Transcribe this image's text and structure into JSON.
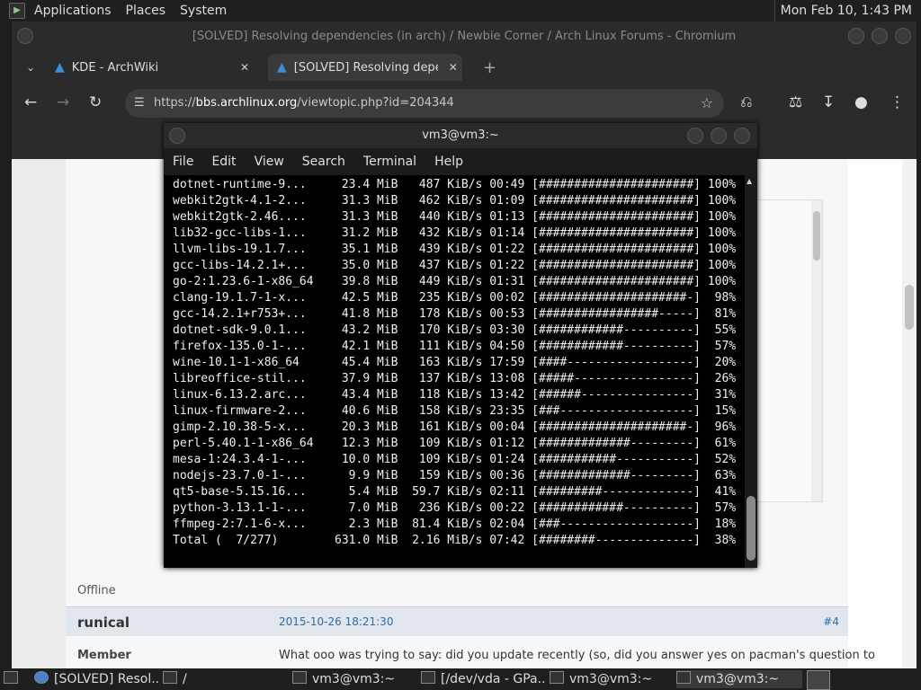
{
  "top_panel": {
    "menus": [
      "Applications",
      "Places",
      "System"
    ],
    "clock": "Mon Feb 10,  1:43 PM"
  },
  "chromium": {
    "title": "[SOLVED] Resolving dependencies (in arch) / Newbie Corner / Arch Linux Forums - Chromium",
    "tabs": [
      {
        "label": "KDE - ArchWiki"
      },
      {
        "label": "[SOLVED] Resolving depend"
      }
    ],
    "new_tab": "+",
    "url_prefix": "https://",
    "url_domain": "bbs.archlinux.org",
    "url_path": "/viewtopic.php?id=204344"
  },
  "forum": {
    "offline": "Offline",
    "author": "runical",
    "date": "2015-10-26 18:21:30",
    "post_num": "#4",
    "role": "Member",
    "text": "What ooo was trying to say: did you update recently (so, did you answer yes on pacman's question to"
  },
  "terminal": {
    "title": "vm3@vm3:~",
    "menu": [
      "File",
      "Edit",
      "View",
      "Search",
      "Terminal",
      "Help"
    ],
    "lines": [
      "dotnet-runtime-9...     23.4 MiB   487 KiB/s 00:49 [######################] 100%",
      "webkit2gtk-4.1-2...     31.3 MiB   462 KiB/s 01:09 [######################] 100%",
      "webkit2gtk-2.46....     31.3 MiB   440 KiB/s 01:13 [######################] 100%",
      "lib32-gcc-libs-1...     31.2 MiB   432 KiB/s 01:14 [######################] 100%",
      "llvm-libs-19.1.7...     35.1 MiB   439 KiB/s 01:22 [######################] 100%",
      "gcc-libs-14.2.1+...     35.0 MiB   437 KiB/s 01:22 [######################] 100%",
      "go-2:1.23.6-1-x86_64    39.8 MiB   449 KiB/s 01:31 [######################] 100%",
      "clang-19.1.7-1-x...     42.5 MiB   235 KiB/s 00:02 [#####################-]  98%",
      "gcc-14.2.1+r753+...     41.8 MiB   178 KiB/s 00:53 [#################-----]  81%",
      "dotnet-sdk-9.0.1...     43.2 MiB   170 KiB/s 03:30 [############----------]  55%",
      "firefox-135.0-1-...     42.1 MiB   111 KiB/s 04:50 [############----------]  57%",
      "wine-10.1-1-x86_64      45.4 MiB   163 KiB/s 17:59 [####------------------]  20%",
      "libreoffice-stil...     37.9 MiB   137 KiB/s 13:08 [#####-----------------]  26%",
      "linux-6.13.2.arc...     43.4 MiB   118 KiB/s 13:42 [######----------------]  31%",
      "linux-firmware-2...     40.6 MiB   158 KiB/s 23:35 [###-------------------]  15%",
      "gimp-2.10.38-5-x...     20.3 MiB   161 KiB/s 00:04 [#####################-]  96%",
      "perl-5.40.1-1-x86_64    12.3 MiB   109 KiB/s 01:12 [#############---------]  61%",
      "mesa-1:24.3.4-1-...     10.0 MiB   109 KiB/s 01:24 [###########-----------]  52%",
      "nodejs-23.7.0-1-...      9.9 MiB   159 KiB/s 00:36 [#############---------]  63%",
      "qt5-base-5.15.16...      5.4 MiB  59.7 KiB/s 02:11 [#########-------------]  41%",
      "python-3.13.1-1-...      7.0 MiB   236 KiB/s 00:22 [############----------]  57%",
      "ffmpeg-2:7.1-6-x...      2.3 MiB  81.4 KiB/s 02:04 [###-------------------]  18%",
      "Total (  7/277)        631.0 MiB  2.16 MiB/s 07:42 [########--------------]  38%"
    ]
  },
  "taskbar": {
    "items": [
      {
        "label": "[SOLVED] Resol..."
      },
      {
        "label": "/"
      },
      {
        "label": "vm3@vm3:~"
      },
      {
        "label": "[/dev/vda - GPa..."
      },
      {
        "label": "vm3@vm3:~"
      },
      {
        "label": "vm3@vm3:~"
      }
    ]
  }
}
